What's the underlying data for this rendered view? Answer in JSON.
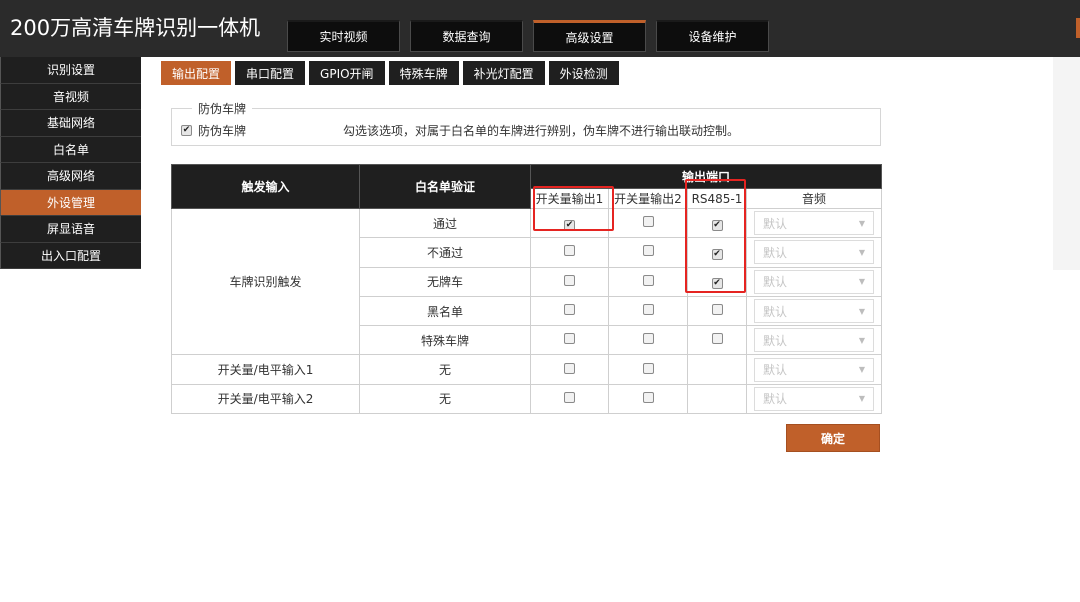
{
  "header": {
    "title": "200万高清车牌识别一体机",
    "nav": [
      {
        "label": "实时视频"
      },
      {
        "label": "数据查询"
      },
      {
        "label": "高级设置"
      },
      {
        "label": "设备维护"
      }
    ],
    "active_nav": "高级设置"
  },
  "sidebar": {
    "items": [
      {
        "label": "识别设置"
      },
      {
        "label": "音视频"
      },
      {
        "label": "基础网络"
      },
      {
        "label": "白名单"
      },
      {
        "label": "高级网络"
      },
      {
        "label": "外设管理"
      },
      {
        "label": "屏显语音"
      },
      {
        "label": "出入口配置"
      }
    ],
    "active": "外设管理"
  },
  "subtabs": {
    "items": [
      {
        "label": "输出配置"
      },
      {
        "label": "串口配置"
      },
      {
        "label": "GPIO开闸"
      },
      {
        "label": "特殊车牌"
      },
      {
        "label": "补光灯配置"
      },
      {
        "label": "外设检测"
      }
    ],
    "active": "输出配置"
  },
  "anti_fake": {
    "legend": "防伪车牌",
    "checkbox_label": "防伪车牌",
    "checked": true,
    "description": "勾选该选项，对属于白名单的车牌进行辨别，伪车牌不进行输出联动控制。"
  },
  "table": {
    "headers": {
      "trigger": "触发输入",
      "whitelist": "白名单验证",
      "outputs": "输出端口",
      "sub": [
        "开关量输出1",
        "开关量输出2",
        "RS485-1",
        "音频"
      ]
    },
    "rows": [
      {
        "trigger": "车牌识别触发",
        "verify": "通过",
        "out1": true,
        "out2": false,
        "rs485": true,
        "audio": "默认"
      },
      {
        "trigger": "",
        "verify": "不通过",
        "out1": false,
        "out2": false,
        "rs485": true,
        "audio": "默认"
      },
      {
        "trigger": "",
        "verify": "无牌车",
        "out1": false,
        "out2": false,
        "rs485": true,
        "audio": "默认"
      },
      {
        "trigger": "",
        "verify": "黑名单",
        "out1": false,
        "out2": false,
        "rs485": false,
        "audio": "默认"
      },
      {
        "trigger": "",
        "verify": "特殊车牌",
        "out1": false,
        "out2": false,
        "rs485": false,
        "audio": "默认"
      },
      {
        "trigger": "开关量/电平输入1",
        "verify": "无",
        "out1": false,
        "out2": false,
        "rs485": null,
        "audio": "默认"
      },
      {
        "trigger": "开关量/电平输入2",
        "verify": "无",
        "out1": false,
        "out2": false,
        "rs485": null,
        "audio": "默认"
      }
    ]
  },
  "confirm_label": "确定",
  "colors": {
    "accent": "#c0602a",
    "dark": "#1f1f1f",
    "annotation": "#e52421"
  }
}
